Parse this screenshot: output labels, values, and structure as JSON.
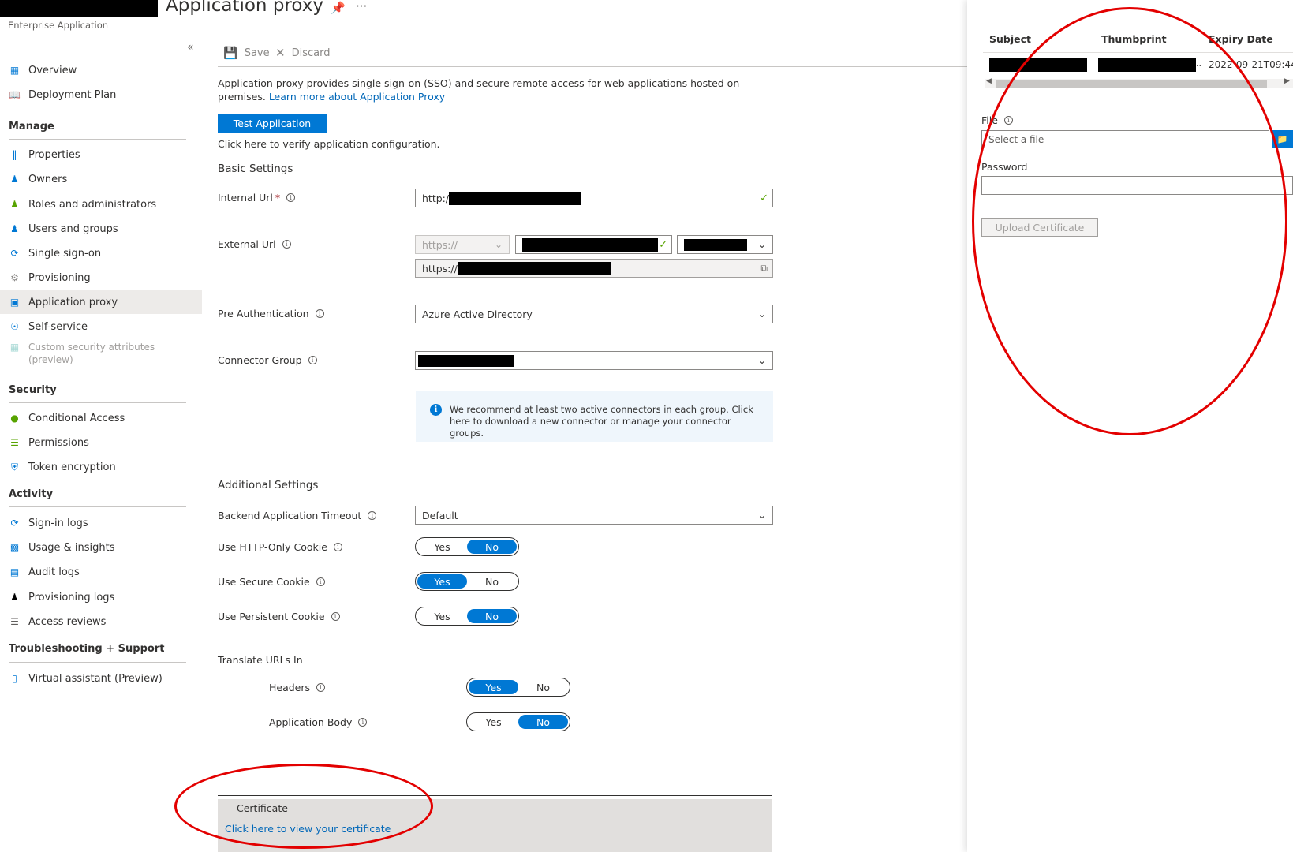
{
  "header": {
    "title": "Application proxy",
    "subtitle": "Enterprise Application",
    "pin_icon": "pin-icon",
    "more_icon": "more-icon"
  },
  "sidebar": {
    "collapse_glyph": "«",
    "items_top": [
      {
        "label": "Overview",
        "icon": "grid-icon"
      },
      {
        "label": "Deployment Plan",
        "icon": "book-icon"
      }
    ],
    "manage": {
      "title": "Manage",
      "items": [
        {
          "label": "Properties",
          "icon": "properties-icon"
        },
        {
          "label": "Owners",
          "icon": "owners-icon"
        },
        {
          "label": "Roles and administrators",
          "icon": "roles-icon"
        },
        {
          "label": "Users and groups",
          "icon": "users-icon"
        },
        {
          "label": "Single sign-on",
          "icon": "sso-icon"
        },
        {
          "label": "Provisioning",
          "icon": "provisioning-icon"
        },
        {
          "label": "Application proxy",
          "icon": "app-proxy-icon",
          "active": true
        },
        {
          "label": "Self-service",
          "icon": "self-service-icon"
        },
        {
          "label": "Custom security attributes",
          "label2": "(preview)",
          "icon": "custom-attr-icon",
          "disabled": true
        }
      ]
    },
    "security": {
      "title": "Security",
      "items": [
        {
          "label": "Conditional Access",
          "icon": "conditional-access-icon"
        },
        {
          "label": "Permissions",
          "icon": "permissions-icon"
        },
        {
          "label": "Token encryption",
          "icon": "shield-icon"
        }
      ]
    },
    "activity": {
      "title": "Activity",
      "items": [
        {
          "label": "Sign-in logs",
          "icon": "signin-logs-icon"
        },
        {
          "label": "Usage & insights",
          "icon": "chart-icon"
        },
        {
          "label": "Audit logs",
          "icon": "audit-icon"
        },
        {
          "label": "Provisioning logs",
          "icon": "person-icon"
        },
        {
          "label": "Access reviews",
          "icon": "list-icon"
        }
      ]
    },
    "support": {
      "title": "Troubleshooting + Support",
      "items": [
        {
          "label": "Virtual assistant (Preview)",
          "icon": "assistant-icon"
        }
      ]
    }
  },
  "toolbar": {
    "save_label": "Save",
    "discard_label": "Discard"
  },
  "main": {
    "description": "Application proxy provides single sign-on (SSO) and secure remote access for web applications hosted on-premises.",
    "learn_more": "Learn more about Application Proxy",
    "test_button": "Test Application",
    "test_hint": "Click here to verify application configuration.",
    "basic_settings": "Basic Settings",
    "internal_url_label": "Internal Url",
    "internal_url_value": "http:/",
    "external_url_label": "External Url",
    "external_url_scheme": "https://",
    "external_url_full": "https://",
    "pre_auth_label": "Pre Authentication",
    "pre_auth_value": "Azure Active Directory",
    "connector_group_label": "Connector Group",
    "connector_info": "We recommend at least two active connectors in each group. Click here to download a new connector or manage your connector groups.",
    "additional_settings": "Additional Settings",
    "backend_timeout_label": "Backend Application Timeout",
    "backend_timeout_value": "Default",
    "http_only_label": "Use HTTP-Only Cookie",
    "secure_cookie_label": "Use Secure Cookie",
    "persistent_cookie_label": "Use Persistent Cookie",
    "translate_urls_label": "Translate URLs In",
    "headers_label": "Headers",
    "app_body_label": "Application Body",
    "yes": "Yes",
    "no": "No",
    "certificate_title": "Certificate",
    "certificate_link": "Click here to view your certificate"
  },
  "panel": {
    "col_subject": "Subject",
    "col_thumbprint": "Thumbprint",
    "col_expiry": "Expiry Date",
    "row_expiry": "2022-09-21T09:44",
    "file_label": "File",
    "file_placeholder": "Select a file",
    "password_label": "Password",
    "upload_button": "Upload Certificate"
  },
  "colors": {
    "accent": "#0078d4",
    "annotation": "#e30000"
  }
}
